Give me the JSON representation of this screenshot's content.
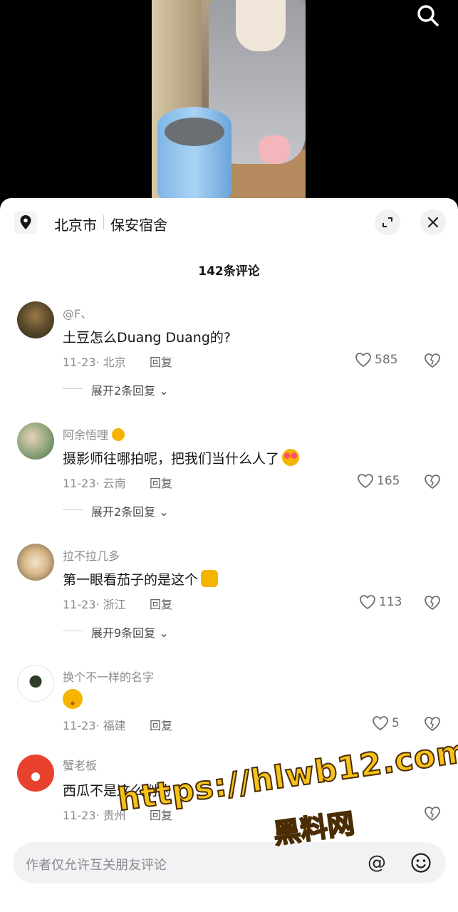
{
  "location": {
    "city": "北京市",
    "place": "保安宿舍"
  },
  "comment_count": "142条评论",
  "comments": [
    {
      "user": "@F、",
      "text": "土豆怎么Duang Duang的?",
      "date": "11-23",
      "region": "北京",
      "reply": "回复",
      "likes": "585",
      "expand": "展开2条回复"
    },
    {
      "user": "阿余悟哩",
      "text": "摄影师往哪拍呢，把我们当什么人了",
      "date": "11-23",
      "region": "云南",
      "reply": "回复",
      "likes": "165",
      "expand": "展开2条回复"
    },
    {
      "user": "拉不拉几多",
      "text": "第一眼看茄子的是这个",
      "date": "11-23",
      "region": "浙江",
      "reply": "回复",
      "likes": "113",
      "expand": "展开9条回复"
    },
    {
      "user": "换个不一样的名字",
      "text": "",
      "date": "11-23",
      "region": "福建",
      "reply": "回复",
      "likes": "5",
      "expand": ""
    },
    {
      "user": "蟹老板",
      "text": "西瓜不是这么削的",
      "date": "11-23",
      "region": "贵州",
      "reply": "回复",
      "likes": "",
      "expand": ""
    }
  ],
  "input": {
    "placeholder": "作者仅允许互关朋友评论",
    "at_symbol": "@"
  },
  "watermark": {
    "url": "https://hlwb12.com",
    "site": "黑料网"
  },
  "colors": {
    "accent_emoji": "#f5b400",
    "heart_emoji": "#ff4d6d",
    "avatar_mrkrabs": "#e8412c"
  }
}
